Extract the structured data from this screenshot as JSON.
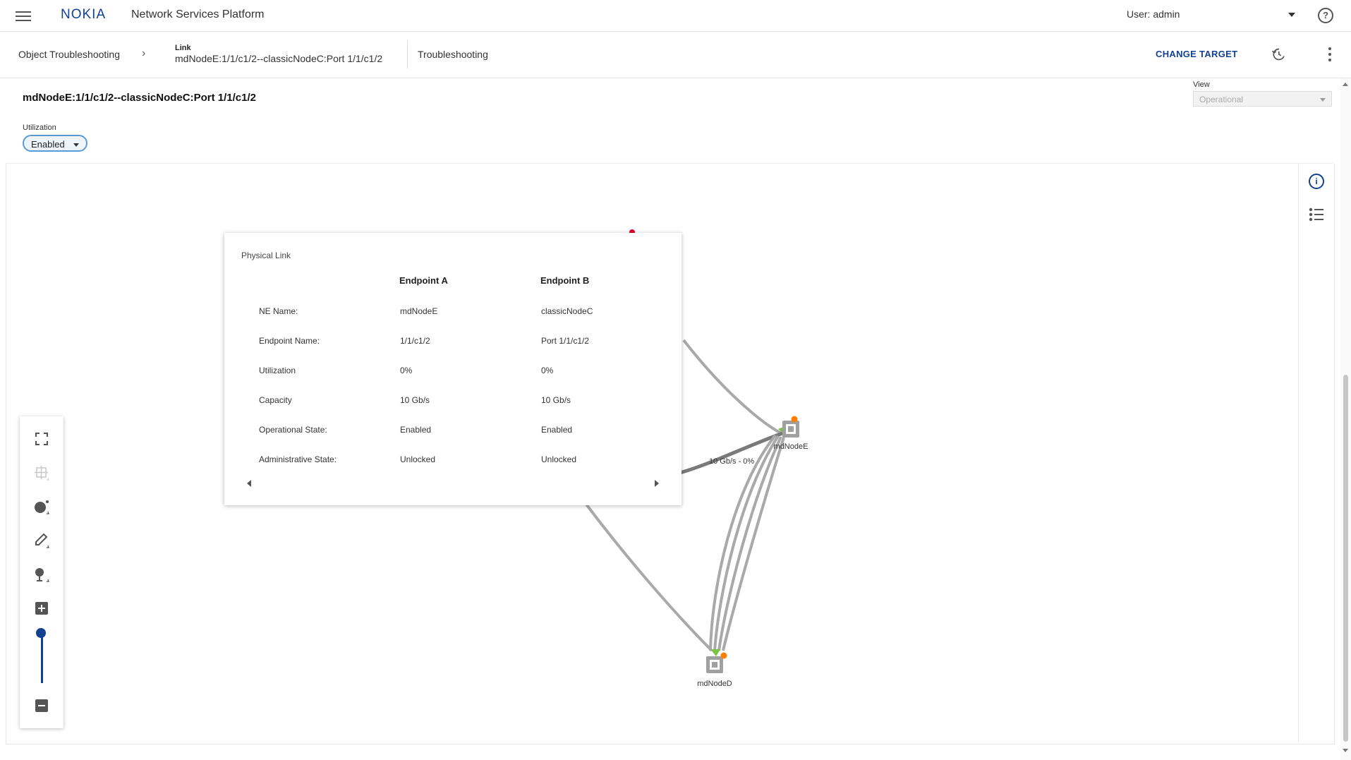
{
  "header": {
    "logo": "NOKIA",
    "app_title": "Network Services Platform",
    "user_label": "User: admin",
    "help_icon": "help-circle-icon",
    "menu_icon": "hamburger-menu-icon"
  },
  "breadcrumb": {
    "root": "Object Troubleshooting",
    "type_label": "Link",
    "current": "mdNodeE:1/1/c1/2--classicNodeC:Port 1/1/c1/2",
    "page": "Troubleshooting",
    "change_target": "CHANGE TARGET",
    "history_icon": "history-icon",
    "more_icon": "kebab-menu-icon"
  },
  "object": {
    "title": "mdNodeE:1/1/c1/2--classicNodeC:Port 1/1/c1/2",
    "utilization_label": "Utilization",
    "utilization_value": "Enabled",
    "view_label": "View",
    "view_value": "Operational"
  },
  "topology": {
    "nodes": [
      {
        "label": "mdNodeE"
      },
      {
        "label": "mdNodeD"
      }
    ],
    "link_label": "10 Gb/s - 0%",
    "colors": {
      "link": "#a9a9a9",
      "link_dark": "#7a7a7a",
      "port_up": "#7dc242",
      "alarm": "#ff7f00",
      "alarm_red": "#e3002b"
    }
  },
  "popup": {
    "title": "Physical Link",
    "col_a": "Endpoint A",
    "col_b": "Endpoint B",
    "rows": [
      {
        "label": "NE Name:",
        "a": "mdNodeE",
        "b": "classicNodeC"
      },
      {
        "label": "Endpoint Name:",
        "a": "1/1/c1/2",
        "b": "Port 1/1/c1/2"
      },
      {
        "label": "Utilization",
        "a": "0%",
        "b": "0%"
      },
      {
        "label": "Capacity",
        "a": "10 Gb/s",
        "b": "10 Gb/s"
      },
      {
        "label": "Operational State:",
        "a": "Enabled",
        "b": "Enabled"
      },
      {
        "label": "Administrative State:",
        "a": "Unlocked",
        "b": "Unlocked"
      }
    ]
  },
  "side_tools": {
    "info_icon": "info-icon",
    "list_icon": "list-icon"
  },
  "map_tools": {
    "icons": [
      "fit-screen-icon",
      "grid-layout-icon",
      "node-style-icon",
      "link-style-icon",
      "map-pin-icon",
      "zoom-in-icon",
      "zoom-out-icon"
    ],
    "zoom_level": 1.0
  },
  "accent_color": "#124191"
}
